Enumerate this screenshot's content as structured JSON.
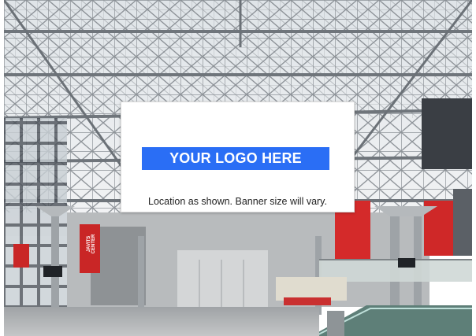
{
  "banner": {
    "logo_text": "YOUR LOGO HERE",
    "caption": "Location as shown. Banner size will vary.",
    "logo_color": "#2a6ef5"
  },
  "scene": {
    "sign_text": [
      "JAVITS",
      "CENTER"
    ],
    "colors": {
      "sky": "#e8ecef",
      "truss": "#8d9297",
      "floor": "#a6a9ab",
      "wall": "#c9cbcc",
      "accent_red": "#d42a2a",
      "dark": "#2b2e33"
    }
  }
}
